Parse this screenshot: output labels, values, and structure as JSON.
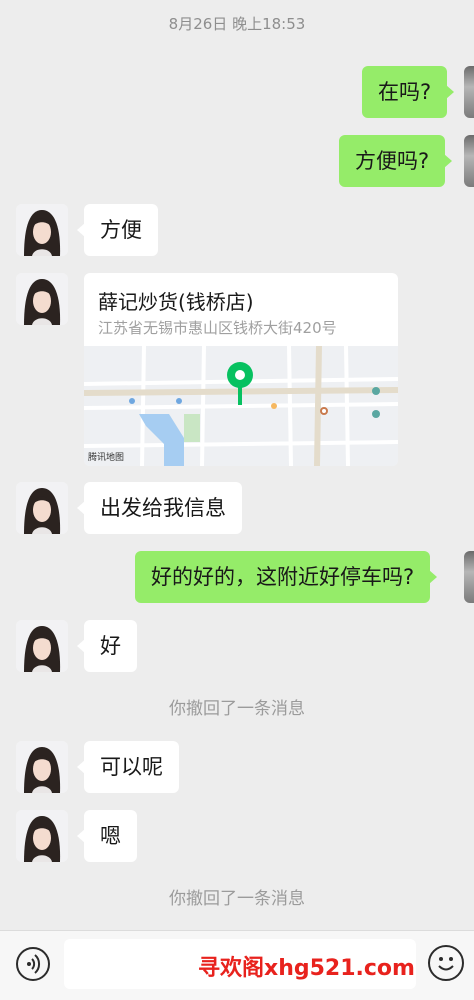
{
  "chat": {
    "timestamp": "8月26日 晚上18:53",
    "messages": [
      {
        "dir": "out",
        "text": "在吗?"
      },
      {
        "dir": "out",
        "text": "方便吗?"
      },
      {
        "dir": "in",
        "text": "方便"
      },
      {
        "dir": "in",
        "text": "出发给我信息"
      },
      {
        "dir": "out",
        "text": "好的好的，这附近好停车吗?"
      },
      {
        "dir": "in",
        "text": "好"
      },
      {
        "dir": "in",
        "text": "可以呢"
      },
      {
        "dir": "in",
        "text": "嗯"
      }
    ],
    "location": {
      "title": "薛记炒货(钱桥店)",
      "address": "江苏省无锡市惠山区钱桥大街420号",
      "map_credit": "腾讯地图",
      "pin_color": "#07c160"
    },
    "recalled_notice": "你撤回了一条消息",
    "input": {
      "value": ""
    },
    "accent_colors": {
      "out_bubble": "#95ec69",
      "in_bubble": "#ffffff",
      "background": "#ededed"
    },
    "icons": [
      "voice-icon",
      "emoji-icon"
    ]
  },
  "watermark": "寻欢阁xhg521.com"
}
